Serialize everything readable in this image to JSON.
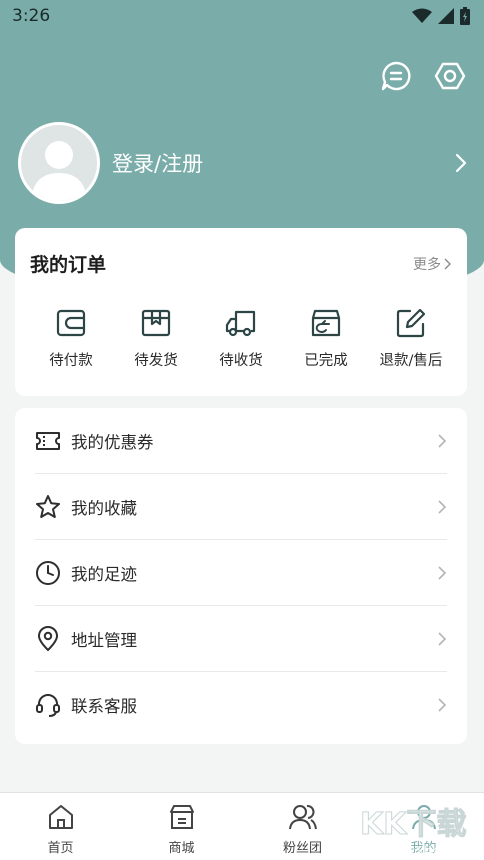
{
  "status_bar": {
    "time": "3:26"
  },
  "header": {
    "login_text": "登录/注册"
  },
  "orders": {
    "title": "我的订单",
    "more": "更多",
    "items": [
      {
        "label": "待付款",
        "icon": "wallet-icon"
      },
      {
        "label": "待发货",
        "icon": "package-icon"
      },
      {
        "label": "待收货",
        "icon": "truck-icon"
      },
      {
        "label": "已完成",
        "icon": "box-check-icon"
      },
      {
        "label": "退款/售后",
        "icon": "edit-icon"
      }
    ]
  },
  "menu": {
    "items": [
      {
        "label": "我的优惠券",
        "icon": "coupon-icon"
      },
      {
        "label": "我的收藏",
        "icon": "star-icon"
      },
      {
        "label": "我的足迹",
        "icon": "clock-icon"
      },
      {
        "label": "地址管理",
        "icon": "location-icon"
      },
      {
        "label": "联系客服",
        "icon": "headset-icon"
      }
    ]
  },
  "tabbar": {
    "items": [
      {
        "label": "首页",
        "icon": "home-icon"
      },
      {
        "label": "商城",
        "icon": "store-icon"
      },
      {
        "label": "粉丝团",
        "icon": "users-icon"
      },
      {
        "label": "我的",
        "icon": "profile-icon",
        "active": true
      }
    ]
  },
  "watermark": {
    "text": "KK下载",
    "url": "www.kkx.net"
  },
  "colors": {
    "accent": "#7aadaa",
    "background": "#f3f4f4",
    "card": "#ffffff"
  }
}
